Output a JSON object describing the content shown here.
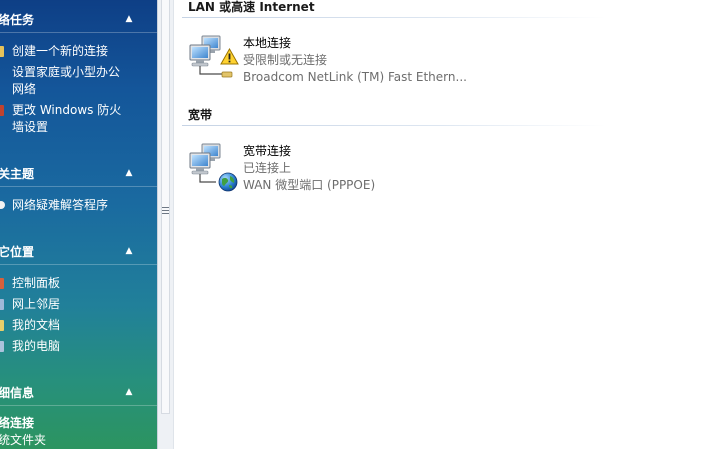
{
  "taskpane": {
    "network_tasks": {
      "title": "络任务",
      "items": [
        {
          "label": "创建一个新的连接"
        },
        {
          "label": "设置家庭或小型办公"
        },
        {
          "label": "网络"
        },
        {
          "label": "更改 Windows 防火"
        },
        {
          "label": "墙设置"
        }
      ]
    },
    "related_topics": {
      "title": "关主题",
      "items": [
        {
          "label": "网络疑难解答程序"
        }
      ]
    },
    "other_places": {
      "title": "它位置",
      "items": [
        {
          "label": "控制面板"
        },
        {
          "label": "网上邻居"
        },
        {
          "label": "我的文档"
        },
        {
          "label": "我的电脑"
        }
      ]
    },
    "details": {
      "title": "细信息",
      "name": "络连接",
      "type": "统文件夹"
    }
  },
  "main": {
    "groups": [
      {
        "header": "LAN 或高速 Internet",
        "connections": [
          {
            "name": "本地连接",
            "status": "受限制或无连接",
            "device": "Broadcom NetLink (TM) Fast Ethern...",
            "badge": "warning-icon"
          }
        ]
      },
      {
        "header": "宽带",
        "connections": [
          {
            "name": "宽带连接",
            "status": "已连接上",
            "device": "WAN 微型端口 (PPPOE)",
            "badge": "globe-icon"
          }
        ]
      }
    ]
  }
}
